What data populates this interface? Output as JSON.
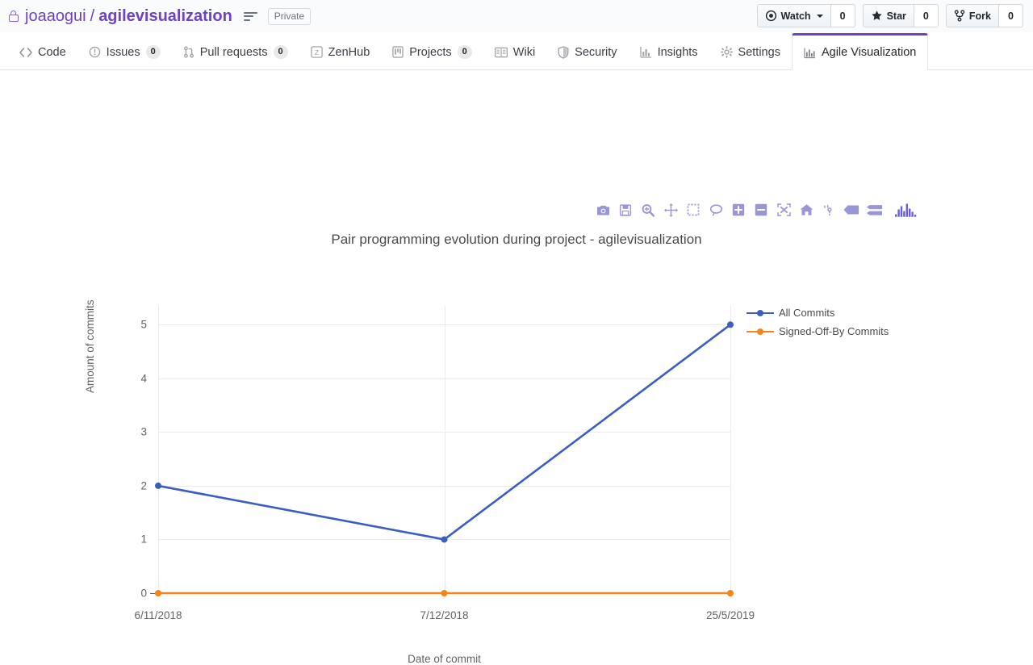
{
  "header": {
    "lock_icon": "lock-icon",
    "owner": "joaaogui",
    "separator": "/",
    "repo": "agilevisualization",
    "lines_icon": "repo-lines-icon",
    "visibility_badge": "Private",
    "actions": [
      {
        "icon": "eye-icon",
        "label": "Watch",
        "count": "0",
        "has_caret": true
      },
      {
        "icon": "star-icon",
        "label": "Star",
        "count": "0",
        "has_caret": false
      },
      {
        "icon": "fork-icon",
        "label": "Fork",
        "count": "0",
        "has_caret": false
      }
    ]
  },
  "nav": {
    "tabs": [
      {
        "icon": "code-icon",
        "label": "Code",
        "count": null,
        "active": false
      },
      {
        "icon": "issue-opened-icon",
        "label": "Issues",
        "count": "0",
        "active": false
      },
      {
        "icon": "git-pull-request-icon",
        "label": "Pull requests",
        "count": "0",
        "active": false
      },
      {
        "icon": "zenhub-icon",
        "label": "ZenHub",
        "count": null,
        "active": false
      },
      {
        "icon": "project-icon",
        "label": "Projects",
        "count": "0",
        "active": false
      },
      {
        "icon": "book-icon",
        "label": "Wiki",
        "count": null,
        "active": false
      },
      {
        "icon": "shield-icon",
        "label": "Security",
        "count": null,
        "active": false
      },
      {
        "icon": "graph-icon",
        "label": "Insights",
        "count": null,
        "active": false
      },
      {
        "icon": "gear-icon",
        "label": "Settings",
        "count": null,
        "active": false
      },
      {
        "icon": "bar-chart-icon",
        "label": "Agile Visualization",
        "count": null,
        "active": true
      }
    ],
    "active_tab_accent": "#6f42c1"
  },
  "modebar": {
    "buttons": [
      {
        "icon": "camera-icon",
        "title": "Download plot as a png"
      },
      {
        "icon": "disk-icon",
        "title": "Edit in Chart Studio"
      },
      {
        "icon": "zoom-icon",
        "title": "Zoom"
      },
      {
        "icon": "pan-icon",
        "title": "Pan"
      },
      {
        "icon": "box-select-icon",
        "title": "Box Select"
      },
      {
        "icon": "lasso-select-icon",
        "title": "Lasso Select"
      },
      {
        "icon": "zoom-in-icon",
        "title": "Zoom in"
      },
      {
        "icon": "zoom-out-icon",
        "title": "Zoom out"
      },
      {
        "icon": "autoscale-icon",
        "title": "Autoscale"
      },
      {
        "icon": "home-icon",
        "title": "Reset axes"
      },
      {
        "icon": "spike-lines-icon",
        "title": "Toggle Spike Lines"
      },
      {
        "icon": "hover-closest-icon",
        "title": "Show closest data on hover"
      },
      {
        "icon": "hover-compare-icon",
        "title": "Compare data on hover"
      }
    ],
    "logo": "plotly-logo-icon",
    "color": "#9a96d6"
  },
  "chart_data": {
    "type": "line",
    "title": "Pair programming evolution during project - agilevisualization",
    "xlabel": "Date of commit",
    "ylabel": "Amount of commits",
    "categories": [
      "6/11/2018",
      "7/12/2018",
      "25/5/2019"
    ],
    "xtick_labels": [
      "6/11/2018",
      "7/12/2018",
      "25/5/2019"
    ],
    "ytick_labels": [
      "0",
      "1",
      "2",
      "3",
      "4",
      "5"
    ],
    "ylim": [
      0,
      5.35
    ],
    "grid": true,
    "legend_position": "right",
    "series": [
      {
        "name": "All Commits",
        "color": "#3b5fc0",
        "values": [
          2,
          1,
          5
        ]
      },
      {
        "name": "Signed-Off-By Commits",
        "color": "#f58518",
        "values": [
          0,
          0,
          0
        ]
      }
    ]
  }
}
